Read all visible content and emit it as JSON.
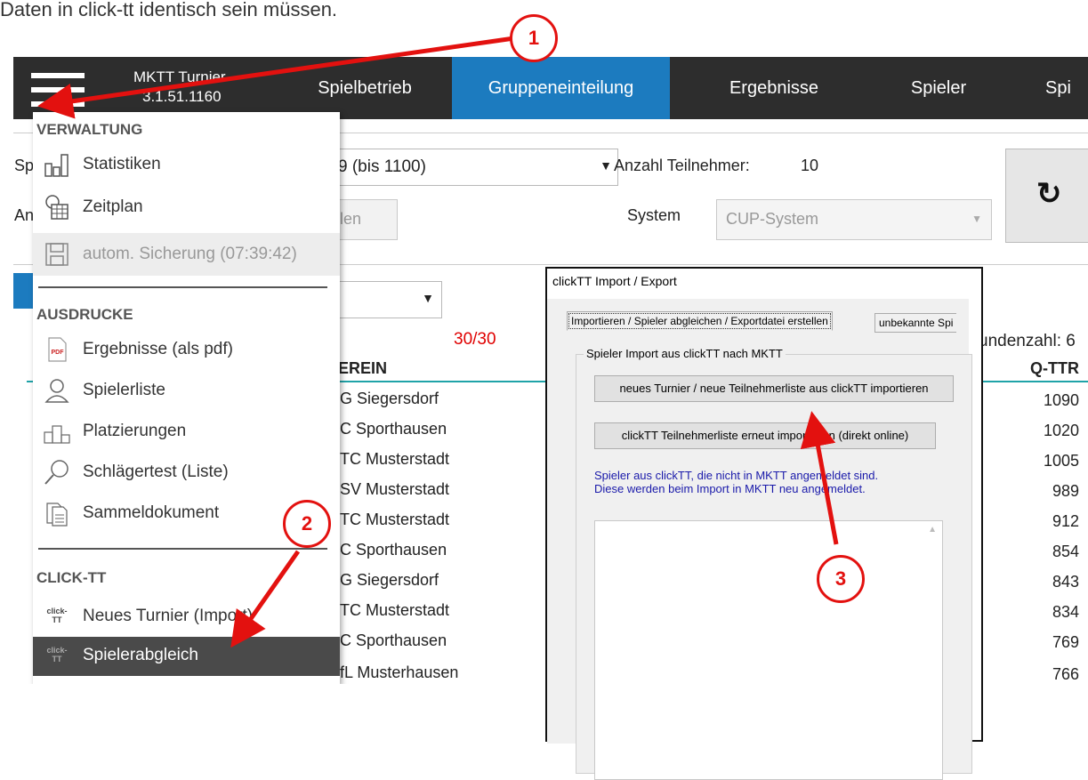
{
  "caption": "Daten in click-tt identisch sein müssen.",
  "app": {
    "title": "MKTT Turnier",
    "version": "3.1.51.1160",
    "nav": [
      "Spielbetrieb",
      "Gruppeneinteilung",
      "Ergebnisse",
      "Spieler",
      "Spi"
    ],
    "active_nav": "Gruppeneinteilung",
    "accent_color": "#1c7bbf",
    "bar_color": "#2d2d2d"
  },
  "toolbar": {
    "label_sp": "Sp",
    "label_an": "An",
    "competition_value": "9 (bis 1100)",
    "anzahl_label": "Anzahl Teilnehmer:",
    "anzahl_value": "10",
    "button_partial": "llen",
    "system_label": "System",
    "system_value": "CUP-System",
    "refresh_icon": "refresh-icon"
  },
  "list": {
    "count": "30/30",
    "count_color": "#e00000",
    "col_verein": "EREIN",
    "col_qttr": "Q-TTR",
    "runden": "undenzahl: 6",
    "rows": [
      {
        "verein": "G Siegersdorf",
        "ttr": "1090"
      },
      {
        "verein": "C Sporthausen",
        "ttr": "1020"
      },
      {
        "verein": "TC Musterstadt",
        "ttr": "1005"
      },
      {
        "verein": "SV Musterstadt",
        "ttr": "989"
      },
      {
        "verein": "TC Musterstadt",
        "ttr": "912"
      },
      {
        "verein": "C Sporthausen",
        "ttr": "854"
      },
      {
        "verein": "G Siegersdorf",
        "ttr": "843"
      },
      {
        "verein": "TC Musterstadt",
        "ttr": "834"
      },
      {
        "verein": "C Sporthausen",
        "ttr": "769"
      },
      {
        "verein": "fL Musterhausen",
        "ttr": "766"
      }
    ]
  },
  "menu": {
    "sections": {
      "verwaltung": "VERWALTUNG",
      "ausdrucke": "AUSDRUCKE",
      "clicktt": "CLICK-TT"
    },
    "items": {
      "statistiken": "Statistiken",
      "zeitplan": "Zeitplan",
      "sicherung": "autom. Sicherung (07:39:42)",
      "ergebnisse_pdf": "Ergebnisse (als pdf)",
      "spielerliste": "Spielerliste",
      "platzierungen": "Platzierungen",
      "schlaegertest": "Schlägertest (Liste)",
      "sammeldokument": "Sammeldokument",
      "neues_turnier": "Neues Turnier (Import)",
      "spielerabgleich": "Spielerabgleich"
    },
    "pdf_icon_text": "PDF",
    "clicktt_logo": "click-TT"
  },
  "dialog": {
    "title": "clickTT Import / Export",
    "tab_active": "Importieren / Spieler abgleichen / Exportdatei erstellen",
    "tab_other": "unbekannte Spi",
    "group_title": "Spieler Import aus clickTT nach MKTT",
    "button_new": "neues Turnier / neue Teilnehmerliste aus clickTT importieren",
    "button_reimport": "clickTT Teilnehmerliste erneut importieren (direkt online)",
    "info_line1": "Spieler  aus clickTT, die nicht in MKTT angemeldet sind.",
    "info_line2": "Diese werden beim Import in MKTT neu angemeldet."
  },
  "annotations": {
    "badge1": "1",
    "badge2": "2",
    "badge3": "3",
    "color": "#e3110f"
  }
}
